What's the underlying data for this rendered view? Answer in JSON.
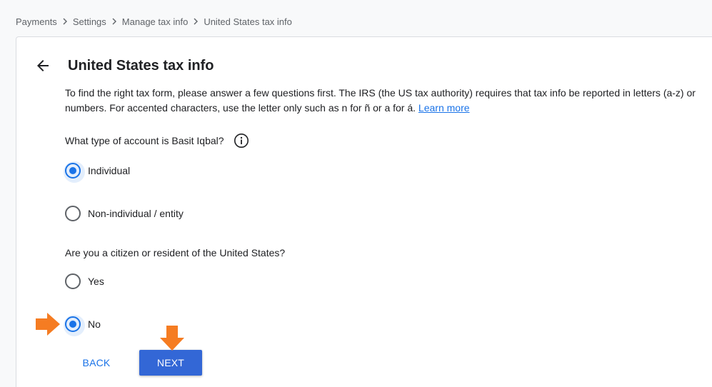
{
  "breadcrumb": {
    "items": [
      "Payments",
      "Settings",
      "Manage tax info"
    ],
    "current": "United States tax info",
    "separator": ">"
  },
  "page": {
    "title": "United States tax info",
    "intro_text": "To find the right tax form, please answer a few questions first. The IRS (the US tax authority) requires that tax info be reported in letters (a-z) or numbers. For accented characters, use the letter only such as n for ñ or a for á.",
    "learn_more_label": "Learn more"
  },
  "question_account_type": {
    "label": "What type of account is Basit Iqbal?",
    "options": [
      {
        "label": "Individual",
        "selected": true
      },
      {
        "label": "Non-individual / entity",
        "selected": false
      }
    ]
  },
  "question_citizen": {
    "label": "Are you a citizen or resident of the United States?",
    "options": [
      {
        "label": "Yes",
        "selected": false
      },
      {
        "label": "No",
        "selected": true
      }
    ]
  },
  "buttons": {
    "back_label": "BACK",
    "next_label": "NEXT"
  },
  "colors": {
    "accent": "#1a73e8",
    "primary_button": "#3367d6",
    "annotation_arrow": "#f57c22"
  },
  "icons": [
    "arrow-left-icon",
    "info-icon",
    "chevron-right-icon"
  ]
}
